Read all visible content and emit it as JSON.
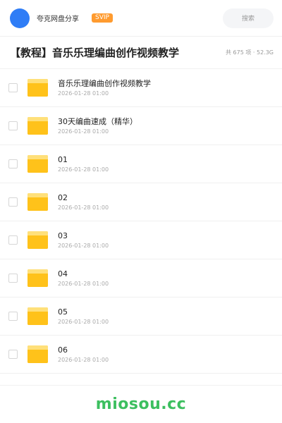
{
  "header": {
    "avatar_color": "#2f7df6",
    "username": "夸克网盘分享",
    "badge": "SVIP",
    "search_placeholder": "搜索"
  },
  "share": {
    "title": "【教程】音乐乐理编曲创作视频教学",
    "summary": "共 675 项 · 52.3G"
  },
  "files": [
    {
      "name": "音乐乐理编曲创作视频教学",
      "date": "2026-01-28 01:00",
      "icon": "folder-icon"
    },
    {
      "name": "30天编曲速成（精华）",
      "date": "2026-01-28 01:00",
      "icon": "folder-icon"
    },
    {
      "name": "01",
      "date": "2026-01-28 01:00",
      "icon": "folder-icon"
    },
    {
      "name": "02",
      "date": "2026-01-28 01:00",
      "icon": "folder-icon"
    },
    {
      "name": "03",
      "date": "2026-01-28 01:00",
      "icon": "folder-icon"
    },
    {
      "name": "04",
      "date": "2026-01-28 01:00",
      "icon": "folder-icon"
    },
    {
      "name": "05",
      "date": "2026-01-28 01:00",
      "icon": "folder-icon"
    },
    {
      "name": "06",
      "date": "2026-01-28 01:00",
      "icon": "folder-icon"
    }
  ],
  "footer": {
    "watermark": "miosou.cc",
    "watermark_color": "#3cbf5f"
  }
}
